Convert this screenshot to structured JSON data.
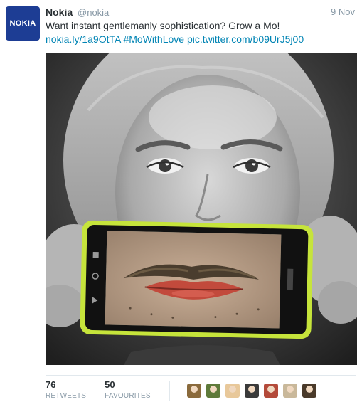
{
  "tweet": {
    "avatar_text": "NOKIA",
    "fullname": "Nokia",
    "username": "@nokia",
    "timestamp": "9 Nov",
    "text_main": "Want instant gentlemanly sophistication? Grow a Mo! ",
    "link1": "nokia.ly/1a9OtTA",
    "hashtag": "#MoWithLove",
    "pic_link": "pic.twitter.com/b09UrJ5j00"
  },
  "stats": {
    "retweets_value": "76",
    "retweets_label": "RETWEETS",
    "favourites_value": "50",
    "favourites_label": "FAVOURITES"
  },
  "favouriters": [
    {
      "color": "#8a6a3c"
    },
    {
      "color": "#5e7a3a"
    },
    {
      "color": "#e8c89a"
    },
    {
      "color": "#3a3a3a"
    },
    {
      "color": "#b44a3a"
    },
    {
      "color": "#c9b89a"
    },
    {
      "color": "#4a3a2a"
    }
  ],
  "colors": {
    "brand_nokia": "#1d3d94",
    "link": "#0084b4",
    "phone_lime": "#c6e43b"
  }
}
